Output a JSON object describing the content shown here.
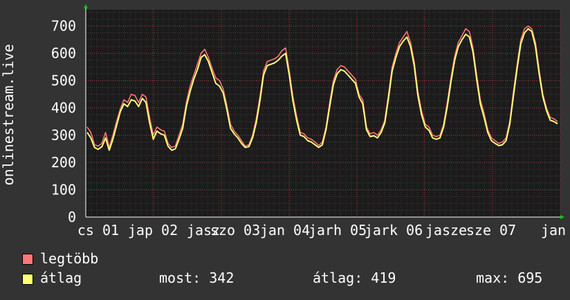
{
  "chart_data": {
    "type": "line",
    "ylabel": "onlinestream.live",
    "ylim": [
      0,
      760
    ],
    "yticks": [
      0,
      100,
      200,
      300,
      400,
      500,
      600,
      700
    ],
    "x_tick_labels": [
      "cs 01",
      "jap 02",
      "jasz",
      "szo 03",
      "jan 04",
      "jarh 05",
      "jark 06",
      "jasze",
      "sze 07",
      "jan"
    ],
    "grid": true,
    "colors": {
      "max": "#ff7777",
      "avg": "#ffff77",
      "background": "#333333",
      "plot": "#1b1b1b"
    },
    "series": [
      {
        "name": "legtöbb",
        "values": [
          330,
          310,
          265,
          260,
          270,
          310,
          255,
          300,
          350,
          395,
          430,
          420,
          450,
          445,
          420,
          450,
          440,
          365,
          300,
          330,
          320,
          315,
          270,
          255,
          260,
          300,
          340,
          420,
          480,
          520,
          560,
          600,
          615,
          585,
          545,
          510,
          500,
          470,
          410,
          340,
          315,
          300,
          280,
          260,
          265,
          300,
          360,
          440,
          535,
          570,
          575,
          580,
          590,
          610,
          620,
          535,
          440,
          370,
          310,
          305,
          290,
          285,
          275,
          262,
          275,
          330,
          420,
          500,
          540,
          555,
          550,
          535,
          520,
          505,
          450,
          430,
          330,
          305,
          310,
          300,
          320,
          355,
          450,
          550,
          600,
          640,
          660,
          680,
          640,
          570,
          460,
          390,
          340,
          330,
          300,
          295,
          300,
          340,
          420,
          510,
          590,
          640,
          665,
          690,
          680,
          620,
          520,
          430,
          380,
          320,
          290,
          280,
          270,
          275,
          290,
          350,
          460,
          560,
          650,
          690,
          700,
          690,
          640,
          540,
          450,
          400,
          365,
          360,
          350
        ]
      },
      {
        "name": "átlag",
        "values": [
          310,
          290,
          255,
          248,
          258,
          290,
          245,
          285,
          335,
          385,
          415,
          405,
          430,
          425,
          405,
          435,
          420,
          345,
          285,
          315,
          305,
          300,
          260,
          245,
          250,
          285,
          325,
          405,
          460,
          505,
          540,
          585,
          595,
          570,
          530,
          490,
          480,
          455,
          395,
          325,
          305,
          290,
          270,
          255,
          258,
          290,
          345,
          425,
          520,
          555,
          560,
          565,
          575,
          590,
          600,
          520,
          425,
          355,
          300,
          295,
          280,
          275,
          265,
          255,
          265,
          320,
          405,
          485,
          525,
          540,
          535,
          520,
          505,
          490,
          440,
          415,
          320,
          295,
          298,
          290,
          310,
          345,
          435,
          535,
          585,
          625,
          645,
          660,
          625,
          555,
          445,
          375,
          330,
          318,
          290,
          285,
          290,
          330,
          405,
          495,
          575,
          625,
          650,
          670,
          660,
          605,
          505,
          415,
          365,
          310,
          280,
          270,
          262,
          265,
          280,
          340,
          445,
          545,
          635,
          675,
          690,
          680,
          625,
          525,
          440,
          390,
          355,
          350,
          342
        ]
      }
    ]
  },
  "legend": {
    "max_label": "legtöbb",
    "avg_label": "átlag"
  },
  "stats": {
    "now": "most: 342",
    "avg": "átlag: 419",
    "max": "max: 695"
  }
}
